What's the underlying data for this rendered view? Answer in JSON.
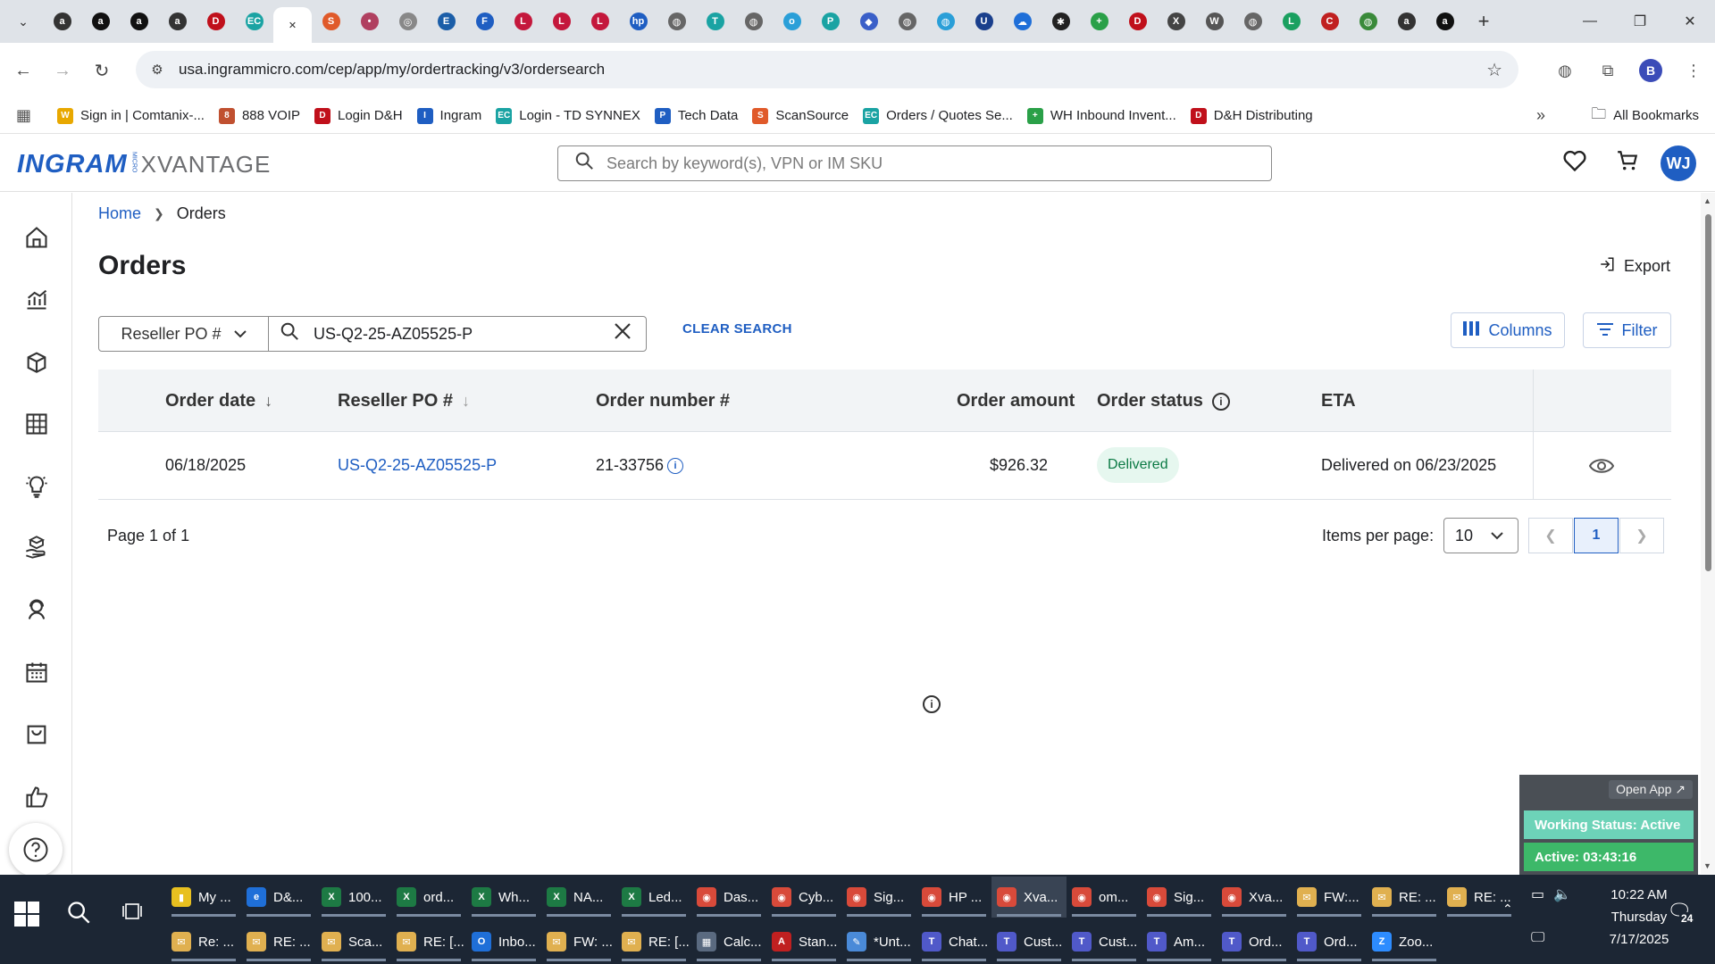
{
  "browser": {
    "url": "usa.ingrammicro.com/cep/app/my/ordertracking/v3/ordersearch",
    "tab_favicons": [
      {
        "name": "amazon",
        "color": "#333333",
        "glyph": "a"
      },
      {
        "name": "amazon",
        "color": "#111111",
        "glyph": "a"
      },
      {
        "name": "amazon",
        "color": "#111111",
        "glyph": "a"
      },
      {
        "name": "amazon",
        "color": "#333333",
        "glyph": "a"
      },
      {
        "name": "dh",
        "color": "#c0101b",
        "glyph": "D"
      },
      {
        "name": "ec",
        "color": "#1aa3a3",
        "glyph": "EC"
      },
      {
        "name": "scansource",
        "color": "#e05a2a",
        "glyph": "S"
      },
      {
        "name": "generic",
        "color": "#b04060",
        "glyph": "•"
      },
      {
        "name": "generic",
        "color": "#888888",
        "glyph": "◎"
      },
      {
        "name": "etn",
        "color": "#1b5ea8",
        "glyph": "E"
      },
      {
        "name": "f",
        "color": "#1f5ec2",
        "glyph": "F"
      },
      {
        "name": "lg",
        "color": "#c4183c",
        "glyph": "L"
      },
      {
        "name": "lg",
        "color": "#c4183c",
        "glyph": "L"
      },
      {
        "name": "lg",
        "color": "#c4183c",
        "glyph": "L"
      },
      {
        "name": "hp",
        "color": "#1f5ec2",
        "glyph": "hp"
      },
      {
        "name": "globe",
        "color": "#666666",
        "glyph": "◍"
      },
      {
        "name": "td",
        "color": "#1aa3a3",
        "glyph": "T"
      },
      {
        "name": "globe",
        "color": "#666666",
        "glyph": "◍"
      },
      {
        "name": "o",
        "color": "#2a9fd8",
        "glyph": "o"
      },
      {
        "name": "p",
        "color": "#1aa3a3",
        "glyph": "P"
      },
      {
        "name": "g",
        "color": "#3a5fc8",
        "glyph": "◆"
      },
      {
        "name": "globe",
        "color": "#666666",
        "glyph": "◍"
      },
      {
        "name": "globe",
        "color": "#2a9fd8",
        "glyph": "◍"
      },
      {
        "name": "u",
        "color": "#1a3f8c",
        "glyph": "U"
      },
      {
        "name": "cloud",
        "color": "#1f6fd8",
        "glyph": "☁"
      },
      {
        "name": "openai",
        "color": "#222222",
        "glyph": "✱"
      },
      {
        "name": "plus",
        "color": "#2aa048",
        "glyph": "+"
      },
      {
        "name": "dh",
        "color": "#c0101b",
        "glyph": "D"
      },
      {
        "name": "x",
        "color": "#444444",
        "glyph": "X"
      },
      {
        "name": "w",
        "color": "#555555",
        "glyph": "W"
      },
      {
        "name": "globe",
        "color": "#666666",
        "glyph": "◍"
      },
      {
        "name": "logi",
        "color": "#1aa060",
        "glyph": "L"
      },
      {
        "name": "car",
        "color": "#c02020",
        "glyph": "C"
      },
      {
        "name": "globe",
        "color": "#3a8a3a",
        "glyph": "◍"
      },
      {
        "name": "amazon",
        "color": "#333333",
        "glyph": "a"
      },
      {
        "name": "amazon",
        "color": "#111111",
        "glyph": "a"
      }
    ],
    "bookmarks": [
      {
        "label": "Sign in | Comtanix-...",
        "color": "#e8a800",
        "glyph": "W"
      },
      {
        "label": "888 VOIP",
        "color": "#c05030",
        "glyph": "8"
      },
      {
        "label": "Login D&H",
        "color": "#c0101b",
        "glyph": "D"
      },
      {
        "label": "Ingram",
        "color": "#1f5ec2",
        "glyph": "I"
      },
      {
        "label": "Login - TD SYNNEX",
        "color": "#1aa3a3",
        "glyph": "EC"
      },
      {
        "label": "Tech Data",
        "color": "#1f5ec2",
        "glyph": "P"
      },
      {
        "label": "ScanSource",
        "color": "#e05a2a",
        "glyph": "S"
      },
      {
        "label": "Orders / Quotes Se...",
        "color": "#1aa3a3",
        "glyph": "EC"
      },
      {
        "label": "WH Inbound Invent...",
        "color": "#2aa048",
        "glyph": "+"
      },
      {
        "label": "D&H Distributing",
        "color": "#c0101b",
        "glyph": "D"
      }
    ],
    "all_bookmarks": "All Bookmarks",
    "profile_initial": "B"
  },
  "app": {
    "logo_main": "INGRAM",
    "logo_micro": "MICRO",
    "logo_product": "XVANTAGE",
    "search_placeholder": "Search by keyword(s), VPN or IM SKU",
    "user_initials": "WJ"
  },
  "breadcrumb": {
    "home": "Home",
    "current": "Orders"
  },
  "page": {
    "title": "Orders",
    "export_label": "Export",
    "search_field": "Reseller PO #",
    "search_value": "US-Q2-25-AZ05525-P",
    "clear_search": "CLEAR SEARCH",
    "columns_label": "Columns",
    "filter_label": "Filter"
  },
  "table": {
    "headers": {
      "order_date": "Order date",
      "reseller_po": "Reseller PO #",
      "order_number": "Order number #",
      "order_amount": "Order amount",
      "order_status": "Order status",
      "eta": "ETA"
    },
    "rows": [
      {
        "order_date": "06/18/2025",
        "reseller_po": "US-Q2-25-AZ05525-P",
        "order_number": "21-33756",
        "order_amount": "$926.32",
        "order_status": "Delivered",
        "eta": "Delivered on 06/23/2025"
      }
    ]
  },
  "pagination": {
    "page_info": "Page 1 of 1",
    "items_per_page_label": "Items per page:",
    "items_per_page": "10",
    "current_page": "1"
  },
  "status_widget": {
    "open_app": "Open App ↗",
    "working_status": "Working Status: Active",
    "active_timer": "Active: 03:43:16"
  },
  "taskbar": {
    "row1": [
      {
        "label": "My ...",
        "color": "#e8c020",
        "glyph": "▮"
      },
      {
        "label": "D&...",
        "color": "#1f6fd8",
        "glyph": "e"
      },
      {
        "label": "100...",
        "color": "#1d7a44",
        "glyph": "X"
      },
      {
        "label": "ord...",
        "color": "#1d7a44",
        "glyph": "X"
      },
      {
        "label": "Wh...",
        "color": "#1d7a44",
        "glyph": "X"
      },
      {
        "label": "NA...",
        "color": "#1d7a44",
        "glyph": "X"
      },
      {
        "label": "Led...",
        "color": "#1d7a44",
        "glyph": "X"
      },
      {
        "label": "Das...",
        "color": "#d84a3a",
        "glyph": "◉"
      },
      {
        "label": "Cyb...",
        "color": "#d84a3a",
        "glyph": "◉"
      },
      {
        "label": "Sig...",
        "color": "#d84a3a",
        "glyph": "◉"
      },
      {
        "label": "HP ...",
        "color": "#d84a3a",
        "glyph": "◉"
      },
      {
        "label": "Xva...",
        "color": "#d84a3a",
        "glyph": "◉"
      },
      {
        "label": "om...",
        "color": "#d84a3a",
        "glyph": "◉"
      },
      {
        "label": "Sig...",
        "color": "#d84a3a",
        "glyph": "◉"
      },
      {
        "label": "Xva...",
        "color": "#d84a3a",
        "glyph": "◉"
      },
      {
        "label": "FW:...",
        "color": "#e0b050",
        "glyph": "✉"
      },
      {
        "label": "RE: ...",
        "color": "#e0b050",
        "glyph": "✉"
      },
      {
        "label": "RE: ...",
        "color": "#e0b050",
        "glyph": "✉"
      }
    ],
    "row2": [
      {
        "label": "Re: ...",
        "color": "#e0b050",
        "glyph": "✉"
      },
      {
        "label": "RE: ...",
        "color": "#e0b050",
        "glyph": "✉"
      },
      {
        "label": "Sca...",
        "color": "#e0b050",
        "glyph": "✉"
      },
      {
        "label": "RE: [...",
        "color": "#e0b050",
        "glyph": "✉"
      },
      {
        "label": "Inbo...",
        "color": "#1f6fd8",
        "glyph": "O"
      },
      {
        "label": "FW: ...",
        "color": "#e0b050",
        "glyph": "✉"
      },
      {
        "label": "RE: [...",
        "color": "#e0b050",
        "glyph": "✉"
      },
      {
        "label": "Calc...",
        "color": "#5a6a80",
        "glyph": "▦"
      },
      {
        "label": "Stan...",
        "color": "#c02020",
        "glyph": "A"
      },
      {
        "label": "*Unt...",
        "color": "#4a8ad8",
        "glyph": "✎"
      },
      {
        "label": "Chat...",
        "color": "#5059c9",
        "glyph": "T"
      },
      {
        "label": "Cust...",
        "color": "#5059c9",
        "glyph": "T"
      },
      {
        "label": "Cust...",
        "color": "#5059c9",
        "glyph": "T"
      },
      {
        "label": "Am...",
        "color": "#5059c9",
        "glyph": "T"
      },
      {
        "label": "Ord...",
        "color": "#5059c9",
        "glyph": "T"
      },
      {
        "label": "Ord...",
        "color": "#5059c9",
        "glyph": "T"
      },
      {
        "label": "Zoo...",
        "color": "#2d8cff",
        "glyph": "Z"
      }
    ],
    "time": "10:22 AM",
    "day": "Thursday",
    "date": "7/17/2025",
    "notifications": "24"
  }
}
